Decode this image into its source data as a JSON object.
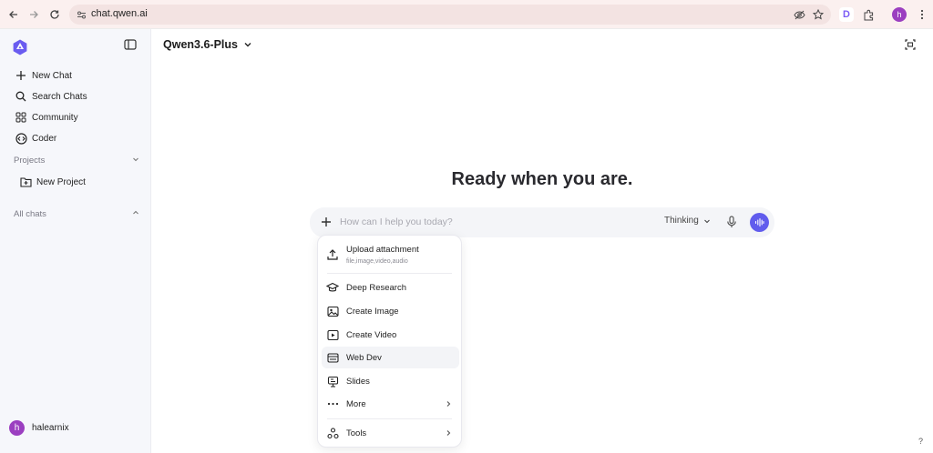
{
  "browser": {
    "url": "chat.qwen.ai",
    "extension_letter": "D",
    "profile_initial": "h"
  },
  "sidebar": {
    "items": [
      {
        "label": "New Chat",
        "icon": "plus-icon"
      },
      {
        "label": "Search Chats",
        "icon": "search-icon"
      },
      {
        "label": "Community",
        "icon": "grid-icon"
      },
      {
        "label": "Coder",
        "icon": "code-icon"
      }
    ],
    "projects_label": "Projects",
    "new_project_label": "New Project",
    "all_chats_label": "All chats",
    "user_name": "halearnix",
    "user_initial": "h"
  },
  "header": {
    "model_name": "Qwen3.6-Plus"
  },
  "main": {
    "hero_text": "Ready when you are.",
    "composer": {
      "placeholder": "How can I help you today?",
      "value": "",
      "mode_label": "Thinking"
    }
  },
  "menu": {
    "upload_label": "Upload attachment",
    "upload_sub": "file,image,video,audio",
    "items": [
      {
        "label": "Deep Research",
        "icon": "graduation-cap-icon"
      },
      {
        "label": "Create Image",
        "icon": "image-icon"
      },
      {
        "label": "Create Video",
        "icon": "video-icon"
      },
      {
        "label": "Web Dev",
        "icon": "web-dev-icon"
      },
      {
        "label": "Slides",
        "icon": "slides-icon"
      },
      {
        "label": "More",
        "icon": "more-dots-icon"
      }
    ],
    "tools_label": "Tools"
  },
  "help_label": "?",
  "colors": {
    "accent": "#615ced",
    "sidebar_bg": "#f6f7fb",
    "avatar": "#9b3fc0",
    "browser_bar": "#fbf0ef"
  }
}
